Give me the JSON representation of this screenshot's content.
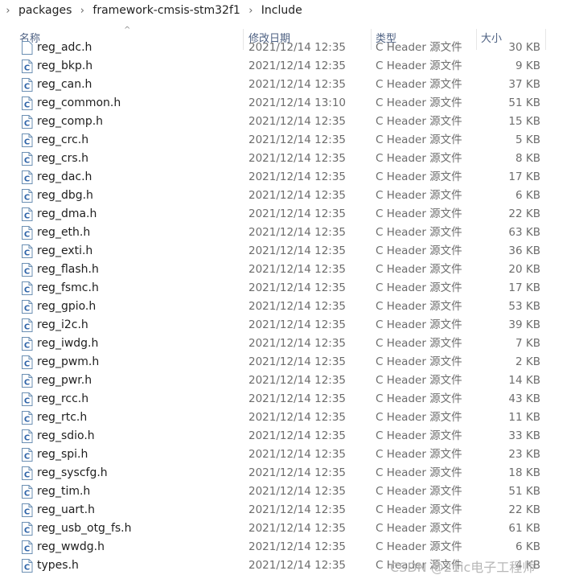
{
  "breadcrumb": {
    "items": [
      "packages",
      "framework-cmsis-stm32f1",
      "Include"
    ]
  },
  "columns": {
    "name": "名称",
    "modified": "修改日期",
    "type": "类型",
    "size": "大小"
  },
  "partial_row": {
    "name": "reg_adc.h",
    "modified": "2021/12/14 12:35",
    "type": "C Header 源文件",
    "size": "30 KB"
  },
  "files": [
    {
      "name": "reg_bkp.h",
      "modified": "2021/12/14 12:35",
      "type": "C Header 源文件",
      "size": "9 KB"
    },
    {
      "name": "reg_can.h",
      "modified": "2021/12/14 12:35",
      "type": "C Header 源文件",
      "size": "37 KB"
    },
    {
      "name": "reg_common.h",
      "modified": "2021/12/14 13:10",
      "type": "C Header 源文件",
      "size": "51 KB"
    },
    {
      "name": "reg_comp.h",
      "modified": "2021/12/14 12:35",
      "type": "C Header 源文件",
      "size": "15 KB"
    },
    {
      "name": "reg_crc.h",
      "modified": "2021/12/14 12:35",
      "type": "C Header 源文件",
      "size": "5 KB"
    },
    {
      "name": "reg_crs.h",
      "modified": "2021/12/14 12:35",
      "type": "C Header 源文件",
      "size": "8 KB"
    },
    {
      "name": "reg_dac.h",
      "modified": "2021/12/14 12:35",
      "type": "C Header 源文件",
      "size": "17 KB"
    },
    {
      "name": "reg_dbg.h",
      "modified": "2021/12/14 12:35",
      "type": "C Header 源文件",
      "size": "6 KB"
    },
    {
      "name": "reg_dma.h",
      "modified": "2021/12/14 12:35",
      "type": "C Header 源文件",
      "size": "22 KB"
    },
    {
      "name": "reg_eth.h",
      "modified": "2021/12/14 12:35",
      "type": "C Header 源文件",
      "size": "63 KB"
    },
    {
      "name": "reg_exti.h",
      "modified": "2021/12/14 12:35",
      "type": "C Header 源文件",
      "size": "36 KB"
    },
    {
      "name": "reg_flash.h",
      "modified": "2021/12/14 12:35",
      "type": "C Header 源文件",
      "size": "20 KB"
    },
    {
      "name": "reg_fsmc.h",
      "modified": "2021/12/14 12:35",
      "type": "C Header 源文件",
      "size": "17 KB"
    },
    {
      "name": "reg_gpio.h",
      "modified": "2021/12/14 12:35",
      "type": "C Header 源文件",
      "size": "53 KB"
    },
    {
      "name": "reg_i2c.h",
      "modified": "2021/12/14 12:35",
      "type": "C Header 源文件",
      "size": "39 KB"
    },
    {
      "name": "reg_iwdg.h",
      "modified": "2021/12/14 12:35",
      "type": "C Header 源文件",
      "size": "7 KB"
    },
    {
      "name": "reg_pwm.h",
      "modified": "2021/12/14 12:35",
      "type": "C Header 源文件",
      "size": "2 KB"
    },
    {
      "name": "reg_pwr.h",
      "modified": "2021/12/14 12:35",
      "type": "C Header 源文件",
      "size": "14 KB"
    },
    {
      "name": "reg_rcc.h",
      "modified": "2021/12/14 12:35",
      "type": "C Header 源文件",
      "size": "43 KB"
    },
    {
      "name": "reg_rtc.h",
      "modified": "2021/12/14 12:35",
      "type": "C Header 源文件",
      "size": "11 KB"
    },
    {
      "name": "reg_sdio.h",
      "modified": "2021/12/14 12:35",
      "type": "C Header 源文件",
      "size": "33 KB"
    },
    {
      "name": "reg_spi.h",
      "modified": "2021/12/14 12:35",
      "type": "C Header 源文件",
      "size": "23 KB"
    },
    {
      "name": "reg_syscfg.h",
      "modified": "2021/12/14 12:35",
      "type": "C Header 源文件",
      "size": "18 KB"
    },
    {
      "name": "reg_tim.h",
      "modified": "2021/12/14 12:35",
      "type": "C Header 源文件",
      "size": "51 KB"
    },
    {
      "name": "reg_uart.h",
      "modified": "2021/12/14 12:35",
      "type": "C Header 源文件",
      "size": "22 KB"
    },
    {
      "name": "reg_usb_otg_fs.h",
      "modified": "2021/12/14 12:35",
      "type": "C Header 源文件",
      "size": "61 KB"
    },
    {
      "name": "reg_wwdg.h",
      "modified": "2021/12/14 12:35",
      "type": "C Header 源文件",
      "size": "6 KB"
    },
    {
      "name": "types.h",
      "modified": "2021/12/14 12:35",
      "type": "C Header 源文件",
      "size": "4 KB"
    }
  ],
  "watermark": "CSDN @21ic电子工程师",
  "icon_name": "c-header-file-icon"
}
